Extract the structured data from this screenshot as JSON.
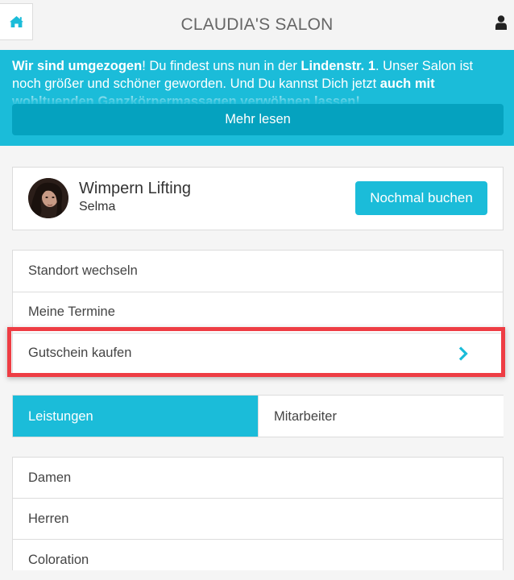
{
  "header": {
    "title": "CLAUDIA'S SALON",
    "home_icon": "home-icon",
    "user_icon": "user-icon"
  },
  "banner": {
    "text_part1": "Wir sind umgezogen",
    "text_part2": "! Du findest uns nun in der ",
    "text_part3": "Lindenstr. 1",
    "text_part4": ". Unser Salon ist noch größer und schöner geworden. Und Du kannst Dich jetzt ",
    "text_part5": "auch mit wohltuenden Ganzkörpermassagen verwöhnen lassen!",
    "button": "Mehr lesen"
  },
  "last_booking": {
    "service": "Wimpern Lifting",
    "staff": "Selma",
    "button": "Nochmal buchen"
  },
  "menu": {
    "items": [
      {
        "label": "Standort wechseln"
      },
      {
        "label": "Meine Termine"
      },
      {
        "label": "Gutschein kaufen"
      }
    ]
  },
  "tabs": {
    "active": "Leistungen",
    "inactive": "Mitarbeiter"
  },
  "categories": [
    {
      "label": "Damen"
    },
    {
      "label": "Herren"
    },
    {
      "label": "Coloration"
    }
  ],
  "colors": {
    "accent": "#1bbcd9",
    "accent_dark": "#05a2bf",
    "highlight": "#ee3d44"
  }
}
